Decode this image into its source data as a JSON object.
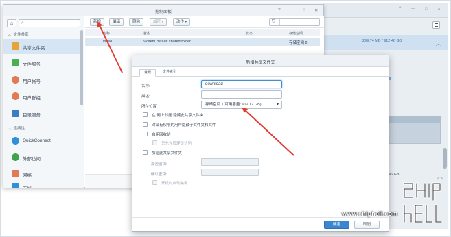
{
  "control_panel": {
    "title": "控制面板",
    "search_placeholder": "",
    "sidebar": {
      "sections": [
        {
          "label": "文件共享"
        },
        {
          "label": "连接性"
        }
      ],
      "items": [
        {
          "label": "共享文件夹",
          "icon": "shared-folder-icon",
          "color": "#e8a23a",
          "active": true
        },
        {
          "label": "文件服务",
          "icon": "file-services-icon",
          "color": "#4caf50"
        },
        {
          "label": "用户帐号",
          "icon": "user-account-icon",
          "color": "#e07b53"
        },
        {
          "label": "用户群组",
          "icon": "user-group-icon",
          "color": "#e07b53"
        },
        {
          "label": "目录服务",
          "icon": "directory-service-icon",
          "color": "#3b7dc4"
        },
        {
          "label": "QuickConnect",
          "icon": "quickconnect-icon",
          "color": "#2f8fd8"
        },
        {
          "label": "外部访问",
          "icon": "external-access-icon",
          "color": "#3fa34d"
        },
        {
          "label": "网络",
          "icon": "network-icon",
          "color": "#e07b53"
        },
        {
          "label": "无线",
          "icon": "wireless-icon",
          "color": "#2f8fd8"
        }
      ]
    },
    "toolbar": {
      "create": "新增",
      "edit": "编辑",
      "delete": "删除",
      "encrypt": "加密 ▾",
      "action": "动作 ▾"
    },
    "table": {
      "headers": [
        "名称",
        "描述",
        "状态",
        "存储空间"
      ],
      "rows": [
        {
          "name": "video",
          "description": "System default shared folder",
          "status": "",
          "volume": "存储空间 2"
        }
      ]
    }
  },
  "background_window": {
    "volume_usage": "299.74 MB / 912.46 GB",
    "bottom_usage": "46 GB"
  },
  "dialog": {
    "title": "新增共享文件夹",
    "tabs": [
      "常规",
      "文件索引"
    ],
    "fields": {
      "name_label": "名称:",
      "name_value": "download",
      "desc_label": "描述:",
      "desc_value": "",
      "location_label": "所在位置:",
      "location_value": "存储空间 1(可用容量: 912.17 GB)"
    },
    "checkboxes": [
      {
        "label": "在\"网上邻居\"隐藏此共享文件夹",
        "disabled": false
      },
      {
        "label": "对没有权限的用户隐藏子文件夹和文件",
        "disabled": false
      },
      {
        "label": "启用回收站",
        "disabled": false
      },
      {
        "label": "只允许管理员访问",
        "disabled": true
      },
      {
        "label": "加密此共享文件夹",
        "disabled": false
      }
    ],
    "encryption": {
      "key_label": "加密密钥:",
      "confirm_label": "确认密钥:",
      "auto_mount": "开机时自动装载"
    },
    "ok": "确定",
    "cancel": "取消"
  },
  "watermark": {
    "url": "www.chiphell.com"
  }
}
